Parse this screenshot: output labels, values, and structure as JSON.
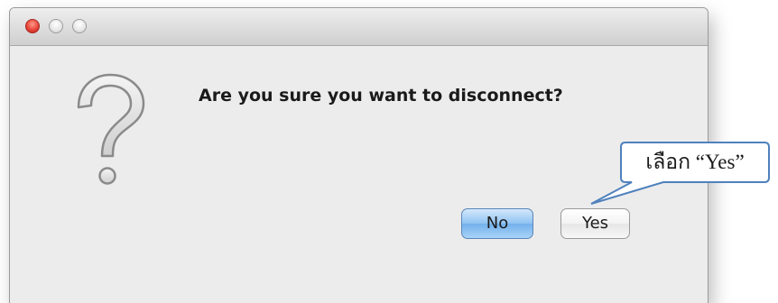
{
  "dialog": {
    "message": "Are you sure you want to disconnect?",
    "icon": "question-mark-icon",
    "buttons": {
      "no_label": "No",
      "yes_label": "Yes"
    },
    "window_controls": [
      "close-icon",
      "minimize-icon",
      "zoom-icon"
    ]
  },
  "annotation": {
    "callout_text": "เลือก “Yes”",
    "border_color": "#4f81bd"
  },
  "colors": {
    "default_button": "#8fc2f2",
    "close_button": "#e8463a"
  }
}
